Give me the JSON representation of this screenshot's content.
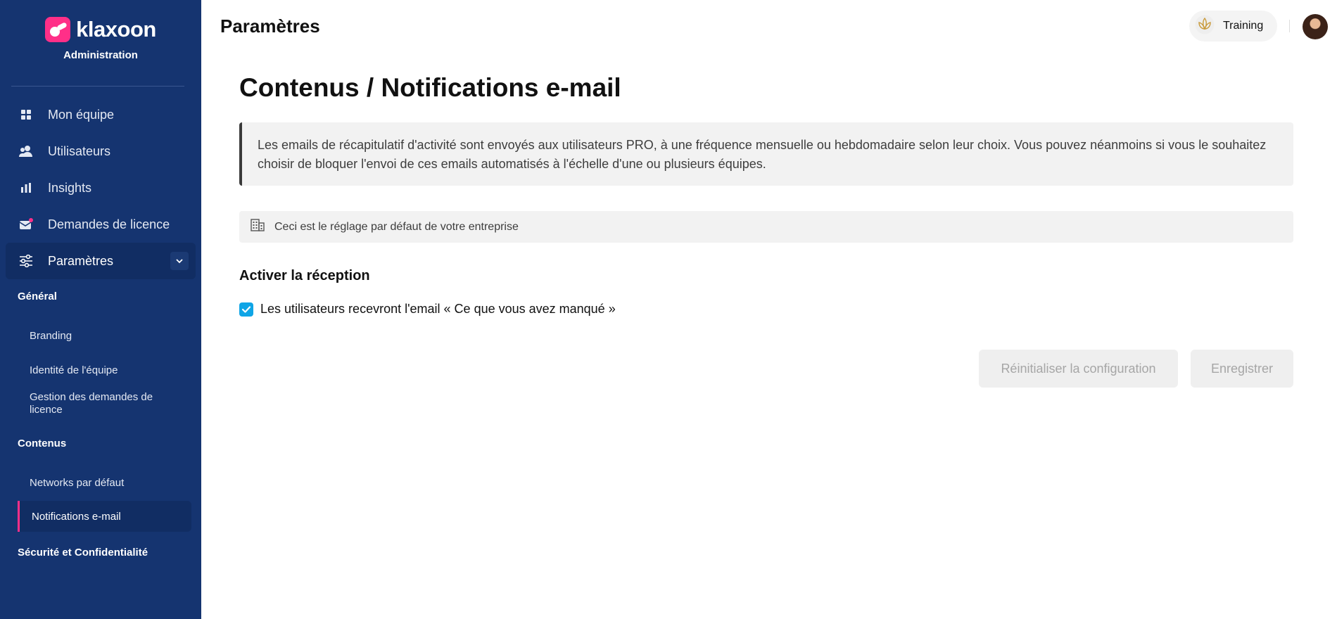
{
  "brand": {
    "name": "klaxoon",
    "subtitle": "Administration",
    "accent": "#ff2f88"
  },
  "sidebar": {
    "bg_color": "#153470",
    "nav": [
      {
        "label": "Mon équipe",
        "icon": "grid-icon"
      },
      {
        "label": "Utilisateurs",
        "icon": "users-icon"
      },
      {
        "label": "Insights",
        "icon": "bar-chart-icon"
      },
      {
        "label": "Demandes de licence",
        "icon": "mail-icon"
      },
      {
        "label": "Paramètres",
        "icon": "sliders-icon",
        "expanded": true
      }
    ],
    "sections": [
      {
        "title": "Général",
        "items": [
          "Branding",
          "Identité de l'équipe",
          "Gestion des demandes de licence"
        ]
      },
      {
        "title": "Contenus",
        "items": [
          "Networks par défaut",
          "Notifications e-mail"
        ],
        "active_item": "Notifications e-mail"
      },
      {
        "title": "Sécurité et Confidentialité",
        "items": []
      }
    ]
  },
  "header": {
    "title": "Paramètres",
    "workspace_label": "Training",
    "avatar": "user-avatar"
  },
  "main": {
    "title": "Contenus / Notifications e-mail",
    "info_line1": "Les emails de récapitulatif d'activité sont envoyés aux utilisateurs PRO, à une fréquence mensuelle ou hebdomadaire selon leur choix. Vous pouvez néanmoins si vous le souhaitez",
    "info_line2": "choisir de bloquer l'envoi de ces emails automatisés à l'échelle d'une ou plusieurs équipes.",
    "default_note": "Ceci est le réglage par défaut de votre entreprise",
    "section_heading": "Activer la réception",
    "checkbox_label": "Les utilisateurs recevront l'email « Ce que vous avez manqué »",
    "checkbox_checked": true,
    "checkbox_color": "#0fa5e6",
    "reset_button": "Réinitialiser la configuration",
    "save_button": "Enregistrer"
  }
}
